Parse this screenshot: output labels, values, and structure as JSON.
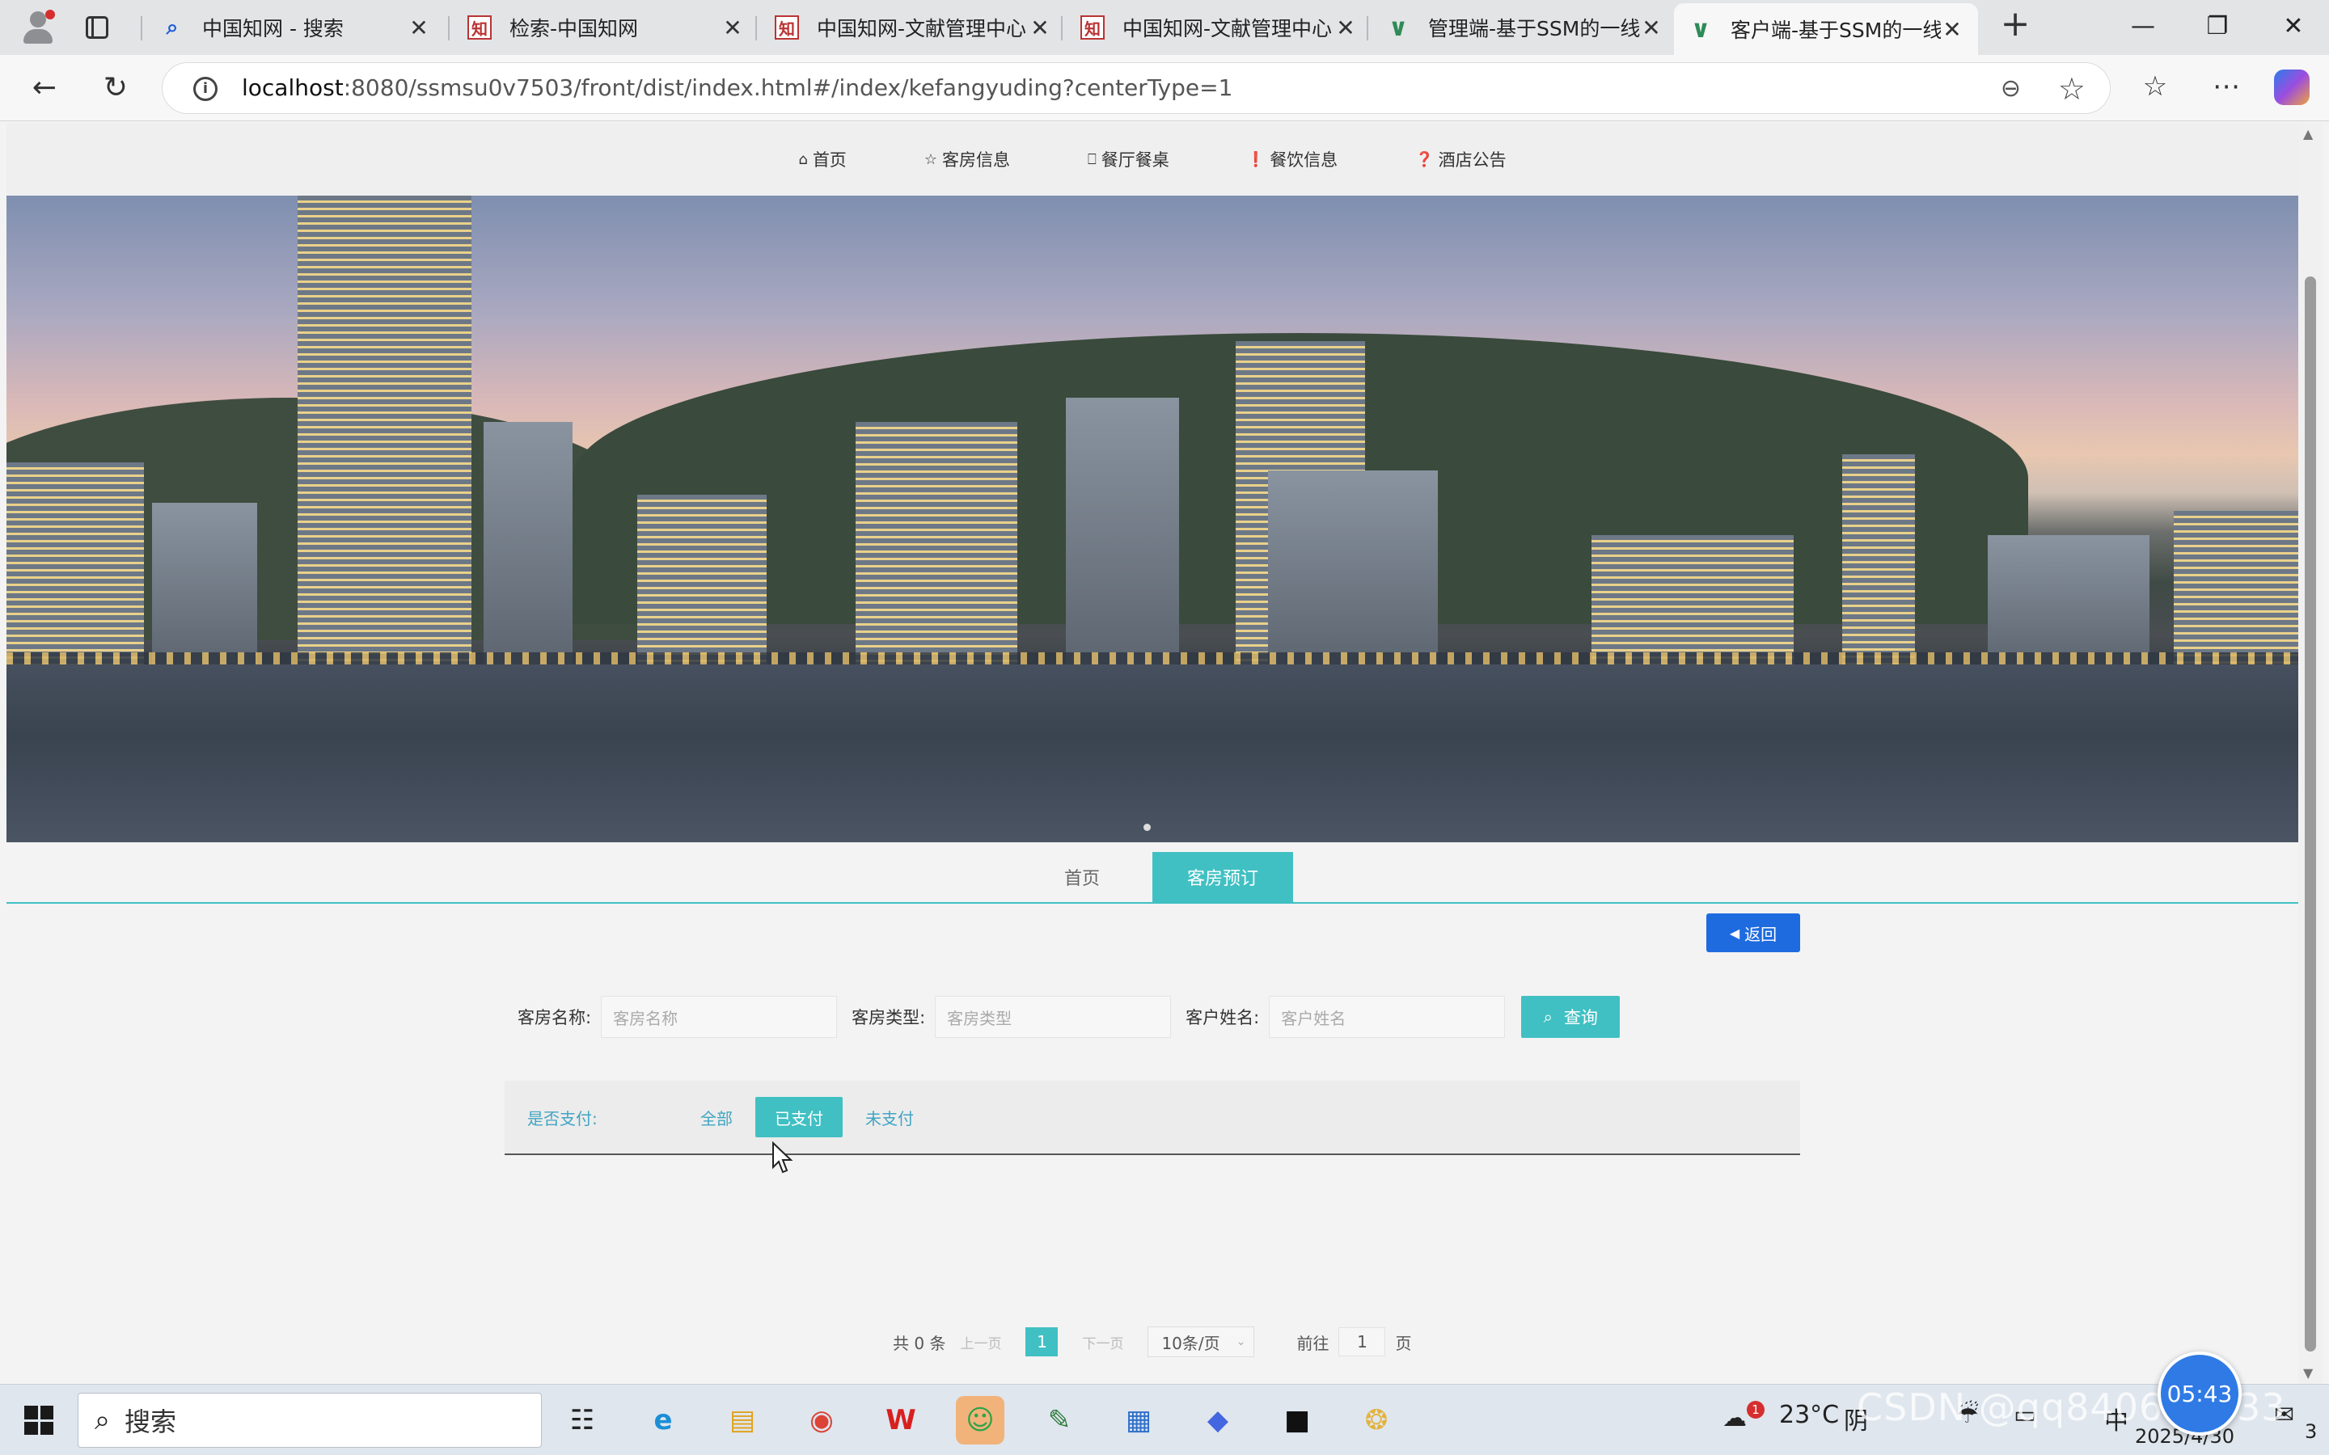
{
  "browser": {
    "tabs": [
      {
        "icon": "search-icon",
        "label": "中国知网 - 搜索"
      },
      {
        "icon": "zhi-logo-icon",
        "label": "检索-中国知网"
      },
      {
        "icon": "zhi-logo-icon",
        "label": "中国知网-文献管理中心"
      },
      {
        "icon": "zhi-logo-icon",
        "label": "中国知网-文献管理中心"
      },
      {
        "icon": "vue-logo-icon",
        "label": "管理端-基于SSM的一线"
      },
      {
        "icon": "vue-logo-icon",
        "label": "客户端-基于SSM的一线"
      }
    ],
    "active_tab_index": 5,
    "url_host": "localhost",
    "url_rest": ":8080/ssmsu0v7503/front/dist/index.html#/index/kefangyuding?centerType=1"
  },
  "page": {
    "nav": [
      {
        "icon": "home-icon",
        "label": "首页"
      },
      {
        "icon": "star-icon",
        "label": "客房信息"
      },
      {
        "icon": "bag-icon",
        "label": "餐厅餐桌"
      },
      {
        "icon": "exclamation-icon",
        "label": "餐饮信息"
      },
      {
        "icon": "question-icon",
        "label": "酒店公告"
      }
    ],
    "breadcrumbs": [
      "首页",
      "客房预订"
    ],
    "back_label": "返回",
    "search": {
      "room_name_label": "客房名称:",
      "room_name_placeholder": "客房名称",
      "room_type_label": "客房类型:",
      "room_type_placeholder": "客房类型",
      "customer_name_label": "客户姓名:",
      "customer_name_placeholder": "客户姓名",
      "query_label": "查询"
    },
    "filter": {
      "label": "是否支付:",
      "options": [
        "全部",
        "已支付",
        "未支付"
      ],
      "selected": "已支付"
    },
    "pager": {
      "total": "共 0 条",
      "prev": "上一页",
      "current_page": "1",
      "next": "下一页",
      "page_size": "10条/页",
      "goto_prefix": "前往",
      "goto_value": "1",
      "goto_suffix": "页"
    }
  },
  "taskbar": {
    "search_placeholder": "搜索",
    "weather": "23°C",
    "weather_desc": "阴",
    "weather_badge": "1",
    "ime": "中",
    "date": "2025/4/30",
    "time_bubble": "05:43",
    "notification_count": "3"
  },
  "watermark": "CSDN @qq840612233"
}
